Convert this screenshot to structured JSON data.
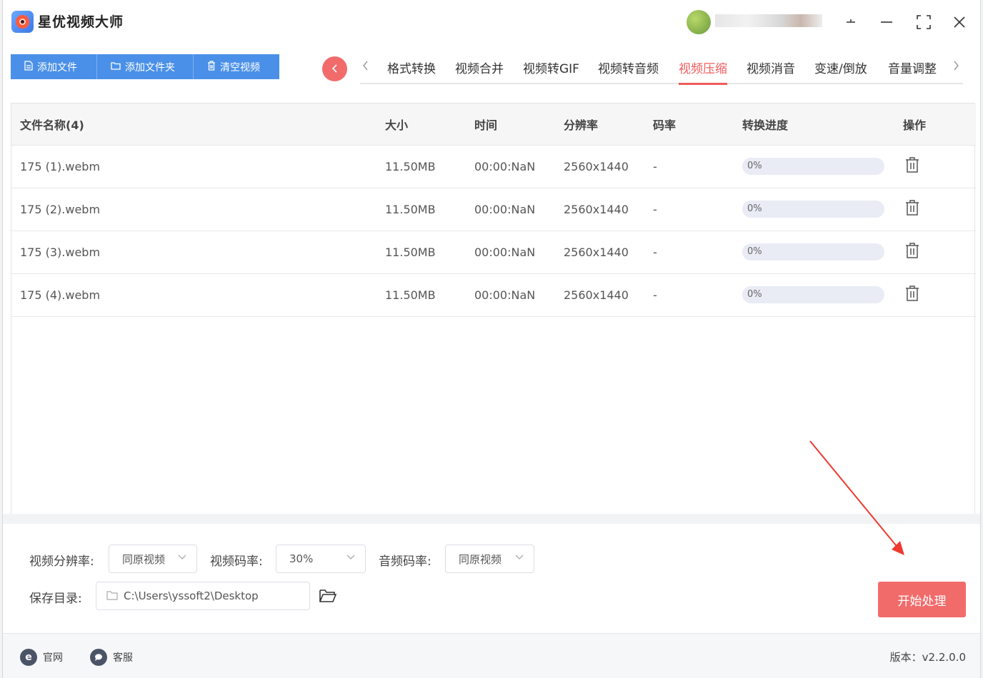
{
  "app": {
    "title": "星优视频大师",
    "user_name": " "
  },
  "toolbar": {
    "add_file": "添加文件",
    "add_folder": "添加文件夹",
    "clear_video": "清空视频"
  },
  "tabs": [
    {
      "label": "格式转换",
      "active": false
    },
    {
      "label": "视频合并",
      "active": false
    },
    {
      "label": "视频转GIF",
      "active": false
    },
    {
      "label": "视频转音频",
      "active": false
    },
    {
      "label": "视频压缩",
      "active": true
    },
    {
      "label": "视频消音",
      "active": false
    },
    {
      "label": "变速/倒放",
      "active": false
    },
    {
      "label": "音量调整",
      "active": false
    }
  ],
  "table": {
    "headers": [
      "文件名称(4)",
      "大小",
      "时间",
      "分辨率",
      "码率",
      "转换进度",
      "操作"
    ],
    "rows": [
      {
        "name": "175 (1).webm",
        "size": "11.50MB",
        "time": "00:00:NaN",
        "resolution": "2560x1440",
        "bitrate": "-",
        "progress": "0%"
      },
      {
        "name": "175 (2).webm",
        "size": "11.50MB",
        "time": "00:00:NaN",
        "resolution": "2560x1440",
        "bitrate": "-",
        "progress": "0%"
      },
      {
        "name": "175 (3).webm",
        "size": "11.50MB",
        "time": "00:00:NaN",
        "resolution": "2560x1440",
        "bitrate": "-",
        "progress": "0%"
      },
      {
        "name": "175 (4).webm",
        "size": "11.50MB",
        "time": "00:00:NaN",
        "resolution": "2560x1440",
        "bitrate": "-",
        "progress": "0%"
      }
    ]
  },
  "settings": {
    "video_resolution_label": "视频分辨率:",
    "video_resolution_value": "同原视频",
    "video_bitrate_label": "视频码率:",
    "video_bitrate_value": "30%",
    "audio_bitrate_label": "音频码率:",
    "audio_bitrate_value": "同原视频",
    "save_dir_label": "保存目录:",
    "save_dir_value": "C:\\Users\\yssoft2\\Desktop",
    "start_label": "开始处理"
  },
  "footer": {
    "website": "官网",
    "support": "客服",
    "version": "版本：v2.2.0.0"
  },
  "colors": {
    "accent_blue": "#4a90e8",
    "accent_red": "#f26b6b"
  },
  "icons": {
    "website": "e",
    "support": "chat-bubble"
  }
}
